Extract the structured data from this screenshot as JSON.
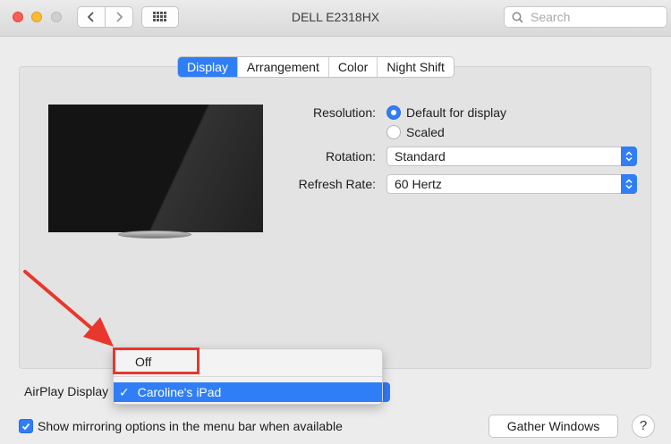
{
  "window": {
    "title": "DELL E2318HX"
  },
  "search": {
    "placeholder": "Search"
  },
  "tabs": [
    {
      "label": "Display",
      "active": true
    },
    {
      "label": "Arrangement",
      "active": false
    },
    {
      "label": "Color",
      "active": false
    },
    {
      "label": "Night Shift",
      "active": false
    }
  ],
  "resolution": {
    "label": "Resolution:",
    "options": [
      {
        "label": "Default for display",
        "selected": true
      },
      {
        "label": "Scaled",
        "selected": false
      }
    ]
  },
  "rotation": {
    "label": "Rotation:",
    "value": "Standard"
  },
  "refresh_rate": {
    "label": "Refresh Rate:",
    "value": "60 Hertz"
  },
  "airplay": {
    "label": "AirPlay Display",
    "menu": {
      "options": [
        {
          "label": "Off",
          "checked": false
        },
        {
          "label": "Caroline's iPad",
          "checked": true
        }
      ],
      "check_mark": "✓"
    }
  },
  "mirroring": {
    "label": "Show mirroring options in the menu bar when available",
    "checked": true
  },
  "gather_button": {
    "label": "Gather Windows"
  },
  "help_button": {
    "label": "?"
  },
  "colors": {
    "accent": "#2f7ef6",
    "annotation": "#e8372d"
  },
  "icons": {
    "back": "chevron-left-icon",
    "forward": "chevron-right-icon",
    "grid": "grid-icon",
    "search": "search-icon",
    "checkmark": "checkmark-icon",
    "popup": "chevron-updown-icon"
  }
}
